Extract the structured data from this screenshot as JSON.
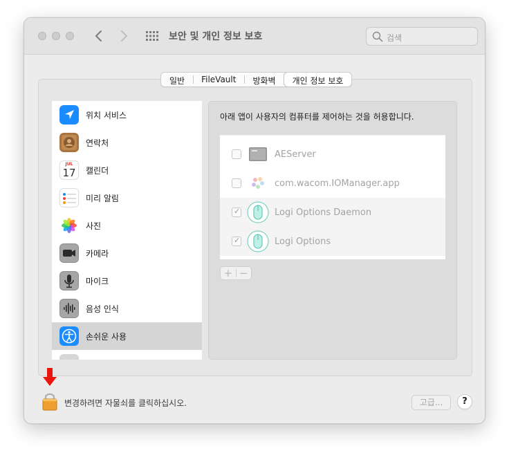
{
  "window": {
    "title": "보안 및 개인 정보 보호",
    "search_placeholder": "검색"
  },
  "tabs": [
    {
      "label": "일반",
      "active": false
    },
    {
      "label": "FileVault",
      "active": false
    },
    {
      "label": "방화벽",
      "active": false
    },
    {
      "label": "개인 정보 보호",
      "active": true
    }
  ],
  "sidebar": {
    "items": [
      {
        "label": "위치 서비스",
        "icon": "location-icon",
        "selected": false
      },
      {
        "label": "연락처",
        "icon": "contacts-icon",
        "selected": false
      },
      {
        "label": "캘린더",
        "icon": "calendar-icon",
        "selected": false
      },
      {
        "label": "미리 알림",
        "icon": "reminders-icon",
        "selected": false
      },
      {
        "label": "사진",
        "icon": "photos-icon",
        "selected": false
      },
      {
        "label": "카메라",
        "icon": "camera-icon",
        "selected": false
      },
      {
        "label": "마이크",
        "icon": "microphone-icon",
        "selected": false
      },
      {
        "label": "음성 인식",
        "icon": "speech-recognition-icon",
        "selected": false
      },
      {
        "label": "손쉬운 사용",
        "icon": "accessibility-icon",
        "selected": true
      }
    ],
    "calendar_icon": {
      "month": "JUL",
      "day": "17"
    }
  },
  "panel": {
    "description": "아래 앱이 사용자의 컴퓨터를 제어하는 것을 허용합니다.",
    "apps": [
      {
        "name": "AEServer",
        "checked": false,
        "icon": "aeserver-icon"
      },
      {
        "name": "com.wacom.IOManager.app",
        "checked": false,
        "icon": "wacom-icon"
      },
      {
        "name": "Logi Options Daemon",
        "checked": true,
        "icon": "logi-mouse-icon"
      },
      {
        "name": "Logi Options",
        "checked": true,
        "icon": "logi-mouse-icon"
      }
    ],
    "add_label": "+",
    "remove_label": "−"
  },
  "footer": {
    "lock_text": "변경하려면 자물쇠를 클릭하십시오.",
    "advanced_label": "고급...",
    "help_label": "?"
  },
  "colors": {
    "arrow": "#e8160c",
    "lock": "#f0a030",
    "accent_blue": "#1a8cff"
  }
}
